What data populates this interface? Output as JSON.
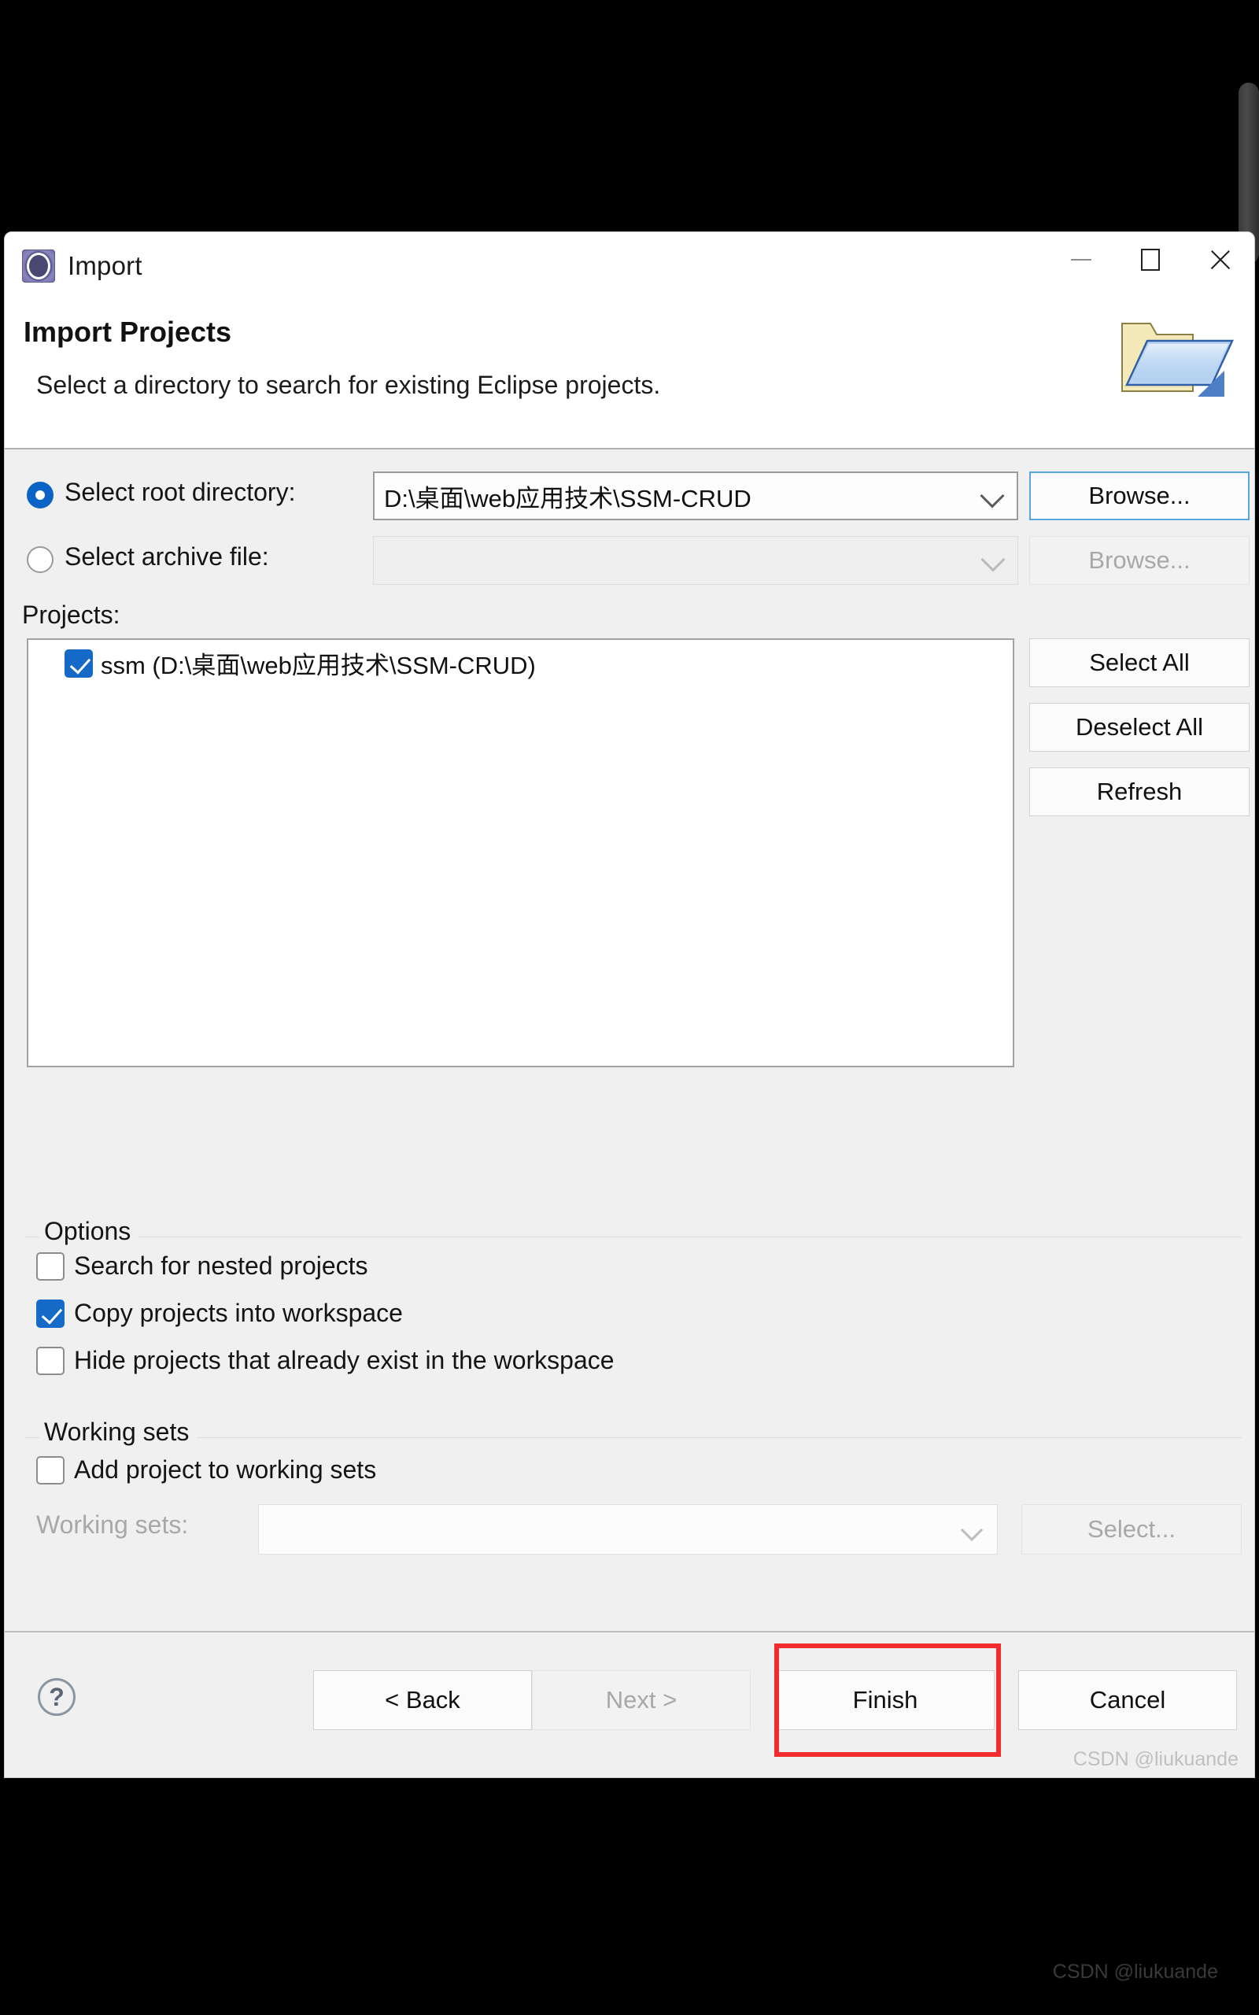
{
  "window": {
    "title": "Import",
    "icon": "eclipse-import-icon",
    "controls": {
      "minimize": "minimize-icon",
      "maximize": "maximize-icon",
      "close": "close-icon"
    }
  },
  "banner": {
    "title": "Import Projects",
    "description": "Select a directory to search for existing Eclipse projects.",
    "icon": "open-folder-import-icon"
  },
  "source": {
    "root_directory": {
      "label": "Select root directory:",
      "selected": true,
      "value": "D:\\桌面\\web应用技术\\SSM-CRUD",
      "browse_label": "Browse...",
      "browse_enabled": true
    },
    "archive_file": {
      "label": "Select archive file:",
      "selected": false,
      "value": "",
      "browse_label": "Browse...",
      "browse_enabled": false
    }
  },
  "projects": {
    "label": "Projects:",
    "items": [
      {
        "checked": true,
        "text": "ssm (D:\\桌面\\web应用技术\\SSM-CRUD)"
      }
    ],
    "buttons": {
      "select_all": "Select All",
      "deselect_all": "Deselect All",
      "refresh": "Refresh"
    }
  },
  "options": {
    "title": "Options",
    "items": [
      {
        "label": "Search for nested projects",
        "checked": false
      },
      {
        "label": "Copy projects into workspace",
        "checked": true
      },
      {
        "label": "Hide projects that already exist in the workspace",
        "checked": false
      }
    ]
  },
  "working_sets": {
    "title": "Working sets",
    "add_checkbox": {
      "label": "Add project to working sets",
      "checked": false
    },
    "combo_label": "Working sets:",
    "combo_value": "",
    "select_button": "Select...",
    "enabled": false
  },
  "footer": {
    "help": "?",
    "back": "< Back",
    "next": "Next >",
    "finish": "Finish",
    "cancel": "Cancel",
    "next_enabled": false,
    "highlight_color": "#f22c2c",
    "highlighted_button": "Finish"
  },
  "watermarks": {
    "inner": "CSDN @liukuande",
    "outer": "CSDN @liukuande"
  }
}
